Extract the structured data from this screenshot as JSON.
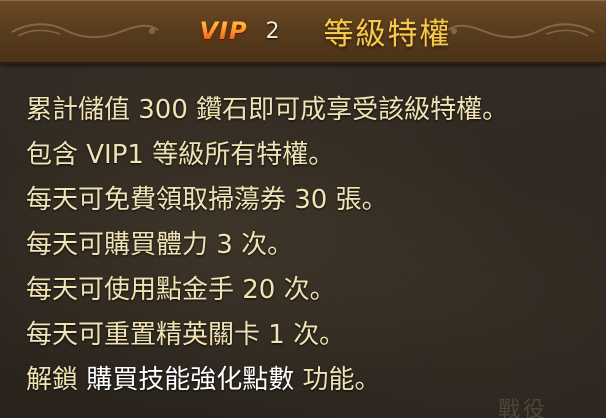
{
  "header": {
    "vip_label": "VIP",
    "vip_level": "2",
    "title": "等級特權"
  },
  "privileges": [
    {
      "text": "累計儲值 300 鑽石即可成享受該級特權。"
    },
    {
      "text": "包含 VIP1 等級所有特權。"
    },
    {
      "text": "每天可免費領取掃蕩券 30 張。"
    },
    {
      "text": "每天可購買體力 3 次。"
    },
    {
      "text": "每天可使用點金手 20 次。"
    },
    {
      "text": "每天可重置精英關卡 1 次。"
    },
    {
      "pre": "解鎖 ",
      "highlight": "購買技能強化點數",
      "post": " 功能。"
    }
  ],
  "watermark": "戰役",
  "colors": {
    "header_bg": "#5a3d1e",
    "title": "#f7c94a",
    "body_text": "#f1e3b4",
    "highlight": "#ffffff",
    "vip_gradient_top": "#ffd45a",
    "vip_gradient_bottom": "#e0451c"
  },
  "icons": {
    "header_left": "scroll-ornament-icon",
    "header_right": "scroll-ornament-icon"
  }
}
